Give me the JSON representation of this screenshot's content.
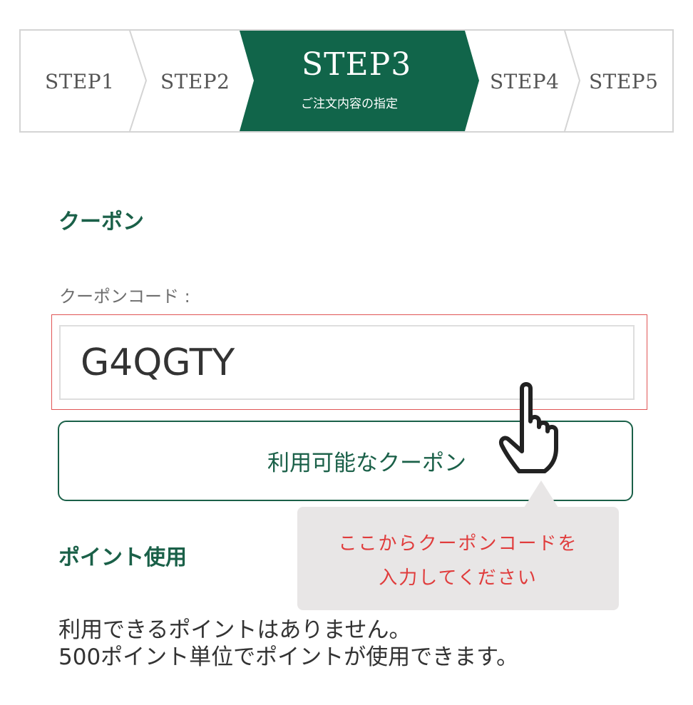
{
  "steps": {
    "step1": "STEP1",
    "step2": "STEP2",
    "step3_title": "STEP3",
    "step3_sub": "ご注文内容の指定",
    "step4": "STEP4",
    "step5": "STEP5"
  },
  "colors": {
    "brand_green": "#1a6048",
    "callout_text": "#e03c3c",
    "highlight_border": "#e05555"
  },
  "coupon": {
    "heading": "クーポン",
    "field_label": "クーポンコード :",
    "code_value": "G4QGTY",
    "available_button": "利用可能なクーポン"
  },
  "callout": {
    "line1": "ここからクーポンコードを",
    "line2": "入力してください"
  },
  "points": {
    "heading": "ポイント使用",
    "line1": "利用できるポイントはありません。",
    "line2": "500ポイント単位でポイントが使用できます。"
  },
  "icons": {
    "cursor": "pointing-hand-icon"
  }
}
